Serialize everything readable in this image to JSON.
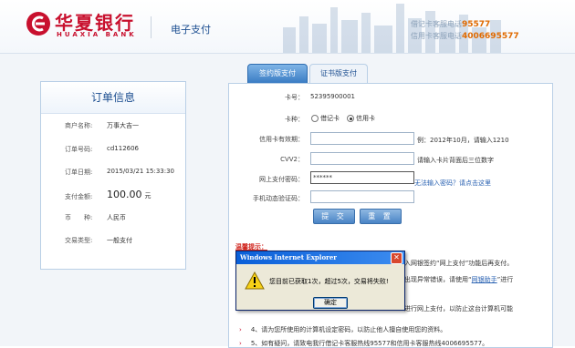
{
  "header": {
    "logo_cn": "华夏银行",
    "logo_en": "HUAXIA BANK",
    "section_title": "电子支付",
    "debit_hotline_label": "借记卡客服电话",
    "debit_hotline_number": "95577",
    "credit_hotline_label": "信用卡客服电话",
    "credit_hotline_number": "4006695577"
  },
  "order": {
    "title": "订单信息",
    "rows": [
      {
        "label": "商户名称:",
        "value": "万事大吉一"
      },
      {
        "label": "订单号码:",
        "value": "cd112606"
      },
      {
        "label": "订单日期:",
        "value": "2015/03/21 15:33:30"
      },
      {
        "label": "支付金额:",
        "value": "100.00",
        "unit": "元"
      },
      {
        "label": "币　　种:",
        "value": "人民币"
      },
      {
        "label": "交易类型:",
        "value": "一般支付"
      }
    ]
  },
  "tabs": [
    {
      "label": "签约版支付",
      "active": true
    },
    {
      "label": "证书版支付",
      "active": false
    }
  ],
  "form": {
    "card_no_label": "卡号：",
    "card_no_value": "52395900001",
    "card_type_label": "卡种：",
    "card_type_options": [
      "借记卡",
      "信用卡"
    ],
    "card_type_selected": "信用卡",
    "expiry_label": "信用卡有效期：",
    "expiry_hint": "例：2012年10月，请输入1210",
    "cvv_label": "CVV2：",
    "cvv_hint": "请输入卡片背面后三位数字",
    "password_label": "网上支付密码：",
    "password_value": "******",
    "password_help": "无法输入密码？请点击这里",
    "sms_label": "手机动态验证码：",
    "submit_label": "提 交",
    "reset_label": "重 置"
  },
  "tips": {
    "title": "温馨提示：",
    "line1_tail": "入网银签约“网上支付”功能后再支付。",
    "line2_tail": "出现异常错误，请使用“",
    "line2_link": "网银助手",
    "line2_end": "”进行",
    "line3_tail": "进行网上支付，以防止这台计算机可能",
    "line4": "4、请为您所使用的计算机设定密码，以防止他人擅自使用您的资料。",
    "line5": "5、如有疑问，请致电我行借记卡客服热线95577和信用卡客服热线4006695577。"
  },
  "dialog": {
    "title": "Windows Internet Explorer",
    "message": "您目前已获取1次，超过5次，交易将失败!",
    "ok_label": "确定",
    "close_glyph": "✕"
  },
  "colors": {
    "brand_red": "#c8102e",
    "accent_blue": "#1d4f91",
    "hotline_orange": "#e06a00"
  }
}
